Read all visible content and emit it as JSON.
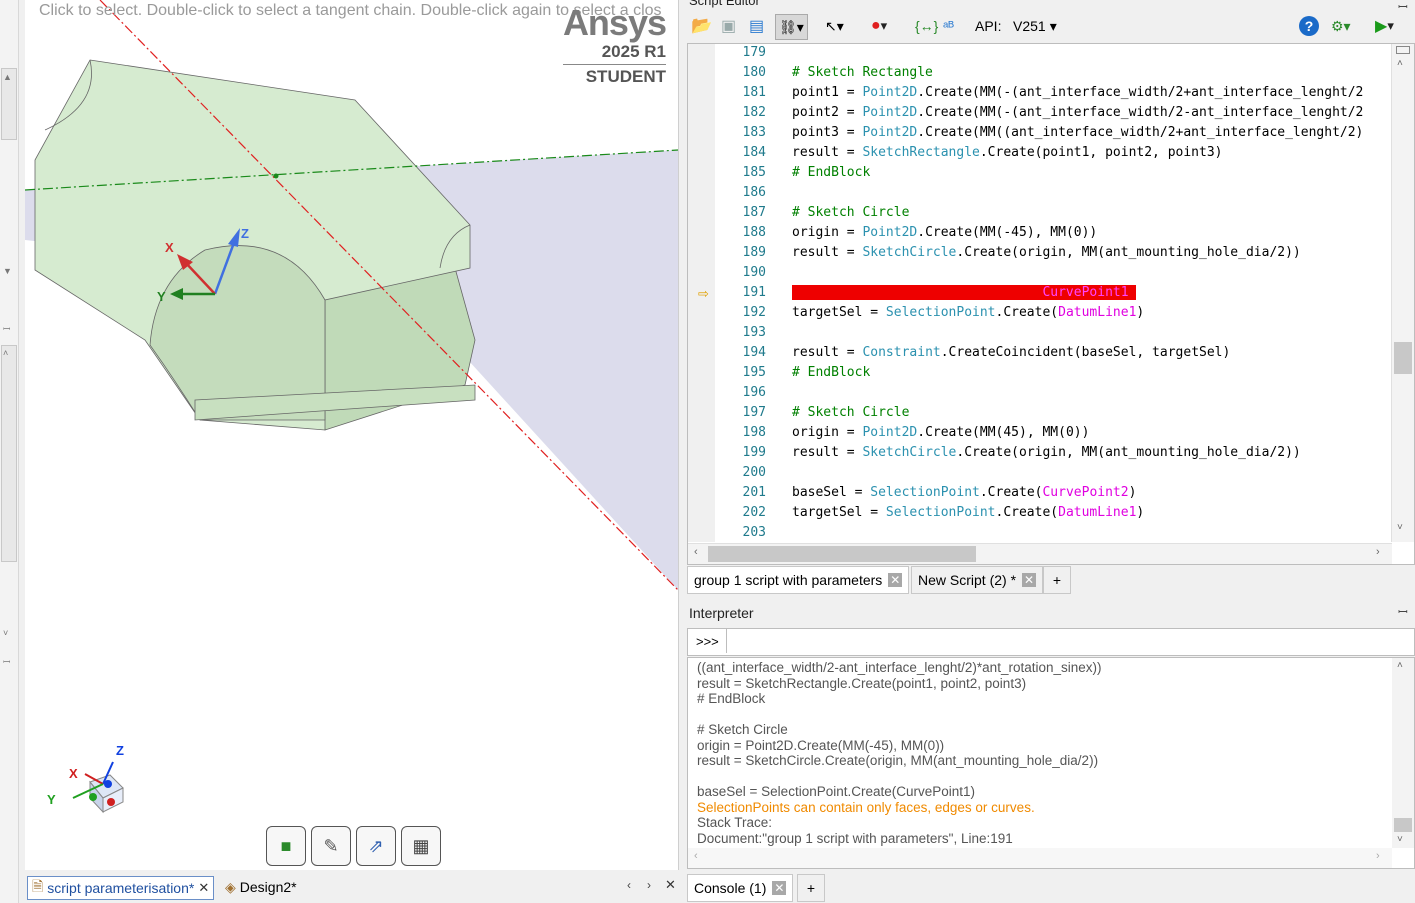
{
  "viewport": {
    "hint": "Click to select. Double-click to select a tangent chain. Double-click again to select a clos",
    "logo": {
      "brand": "Ansys",
      "version": "2025 R1",
      "edition": "STUDENT"
    },
    "triad": {
      "x": "X",
      "y": "Y",
      "z": "Z"
    },
    "mini_triad": {
      "x": "X",
      "y": "Y",
      "z": "Z"
    },
    "bottom_tools": [
      "box-view-icon",
      "sketch-edit-icon",
      "select-tool-icon",
      "display-icon"
    ]
  },
  "doc_tabs": [
    {
      "label": "script parameterisation*",
      "active": true
    },
    {
      "label": "Design2*",
      "active": false
    }
  ],
  "script_editor": {
    "title": "Script Editor",
    "api_label": "API:",
    "api_version": "V251",
    "lines": [
      {
        "n": "179",
        "segs": []
      },
      {
        "n": "180",
        "segs": [
          {
            "t": "# Sketch Rectangle",
            "c": "cm"
          }
        ]
      },
      {
        "n": "181",
        "segs": [
          {
            "t": "point1 = ",
            "c": ""
          },
          {
            "t": "Point2D",
            "c": "ty"
          },
          {
            "t": ".Create(MM(-(ant_interface_width/2+ant_interface_lenght/2",
            "c": ""
          }
        ]
      },
      {
        "n": "182",
        "segs": [
          {
            "t": "point2 = ",
            "c": ""
          },
          {
            "t": "Point2D",
            "c": "ty"
          },
          {
            "t": ".Create(MM(-(ant_interface_width/2-ant_interface_lenght/2",
            "c": ""
          }
        ]
      },
      {
        "n": "183",
        "segs": [
          {
            "t": "point3 = ",
            "c": ""
          },
          {
            "t": "Point2D",
            "c": "ty"
          },
          {
            "t": ".Create(MM((ant_interface_width/2+ant_interface_lenght/2)",
            "c": ""
          }
        ]
      },
      {
        "n": "184",
        "segs": [
          {
            "t": "result = ",
            "c": ""
          },
          {
            "t": "SketchRectangle",
            "c": "ty"
          },
          {
            "t": ".Create(point1, point2, point3)",
            "c": ""
          }
        ]
      },
      {
        "n": "185",
        "segs": [
          {
            "t": "# EndBlock",
            "c": "cm"
          }
        ]
      },
      {
        "n": "186",
        "segs": []
      },
      {
        "n": "187",
        "segs": [
          {
            "t": "# Sketch Circle",
            "c": "cm"
          }
        ]
      },
      {
        "n": "188",
        "segs": [
          {
            "t": "origin = ",
            "c": ""
          },
          {
            "t": "Point2D",
            "c": "ty"
          },
          {
            "t": ".Create(MM(-45), MM(0))",
            "c": ""
          }
        ]
      },
      {
        "n": "189",
        "segs": [
          {
            "t": "result = ",
            "c": ""
          },
          {
            "t": "SketchCircle",
            "c": "ty"
          },
          {
            "t": ".Create(origin, MM(ant_mounting_hole_dia/2))",
            "c": ""
          }
        ]
      },
      {
        "n": "190",
        "segs": []
      },
      {
        "n": "191",
        "hl": true,
        "segs": [
          {
            "t": "baseSel = SelectionPoint.Create(",
            "c": ""
          },
          {
            "t": "CurvePoint1",
            "c": "mg"
          },
          {
            "t": ")",
            "c": ""
          }
        ]
      },
      {
        "n": "192",
        "segs": [
          {
            "t": "targetSel = ",
            "c": ""
          },
          {
            "t": "SelectionPoint",
            "c": "ty"
          },
          {
            "t": ".Create(",
            "c": ""
          },
          {
            "t": "DatumLine1",
            "c": "mg"
          },
          {
            "t": ")",
            "c": ""
          }
        ]
      },
      {
        "n": "193",
        "segs": []
      },
      {
        "n": "194",
        "segs": [
          {
            "t": "result = ",
            "c": ""
          },
          {
            "t": "Constraint",
            "c": "ty"
          },
          {
            "t": ".CreateCoincident(baseSel, targetSel)",
            "c": ""
          }
        ]
      },
      {
        "n": "195",
        "segs": [
          {
            "t": "# EndBlock",
            "c": "cm"
          }
        ]
      },
      {
        "n": "196",
        "segs": []
      },
      {
        "n": "197",
        "segs": [
          {
            "t": "# Sketch Circle",
            "c": "cm"
          }
        ]
      },
      {
        "n": "198",
        "segs": [
          {
            "t": "origin = ",
            "c": ""
          },
          {
            "t": "Point2D",
            "c": "ty"
          },
          {
            "t": ".Create(MM(45), MM(0))",
            "c": ""
          }
        ]
      },
      {
        "n": "199",
        "segs": [
          {
            "t": "result = ",
            "c": ""
          },
          {
            "t": "SketchCircle",
            "c": "ty"
          },
          {
            "t": ".Create(origin, MM(ant_mounting_hole_dia/2))",
            "c": ""
          }
        ]
      },
      {
        "n": "200",
        "segs": []
      },
      {
        "n": "201",
        "segs": [
          {
            "t": "baseSel = ",
            "c": ""
          },
          {
            "t": "SelectionPoint",
            "c": "ty"
          },
          {
            "t": ".Create(",
            "c": ""
          },
          {
            "t": "CurvePoint2",
            "c": "mg"
          },
          {
            "t": ")",
            "c": ""
          }
        ]
      },
      {
        "n": "202",
        "segs": [
          {
            "t": "targetSel = ",
            "c": ""
          },
          {
            "t": "SelectionPoint",
            "c": "ty"
          },
          {
            "t": ".Create(",
            "c": ""
          },
          {
            "t": "DatumLine1",
            "c": "mg"
          },
          {
            "t": ")",
            "c": ""
          }
        ]
      },
      {
        "n": "203",
        "segs": []
      }
    ]
  },
  "script_tabs": [
    {
      "label": "group 1 script with parameters",
      "active": true
    },
    {
      "label": "New Script (2) *",
      "active": false
    }
  ],
  "interpreter": {
    "title": "Interpreter",
    "prompt": ">>>",
    "input_value": "",
    "output": [
      {
        "t": "((ant_interface_width/2-ant_interface_lenght/2)*ant_rotation_sinex))",
        "err": false
      },
      {
        "t": "result = SketchRectangle.Create(point1, point2, point3)",
        "err": false
      },
      {
        "t": "# EndBlock",
        "err": false
      },
      {
        "t": "",
        "err": false
      },
      {
        "t": "# Sketch Circle",
        "err": false
      },
      {
        "t": "origin = Point2D.Create(MM(-45), MM(0))",
        "err": false
      },
      {
        "t": "result = SketchCircle.Create(origin, MM(ant_mounting_hole_dia/2))",
        "err": false
      },
      {
        "t": "",
        "err": false
      },
      {
        "t": "baseSel = SelectionPoint.Create(CurvePoint1)",
        "err": false
      },
      {
        "t": "SelectionPoints can contain only faces, edges or curves.",
        "err": true
      },
      {
        "t": "Stack Trace:",
        "err": false
      },
      {
        "t": "Document:\"group 1 script with parameters\", Line:191",
        "err": false
      }
    ]
  },
  "console_tabs": [
    {
      "label": "Console (1)",
      "active": true
    }
  ],
  "add_tab_label": "+",
  "colors": {
    "highlight": "#ee0000",
    "error": "#f08a00",
    "model_fill": "#cfe6c9",
    "plane": "#dcdcec"
  }
}
